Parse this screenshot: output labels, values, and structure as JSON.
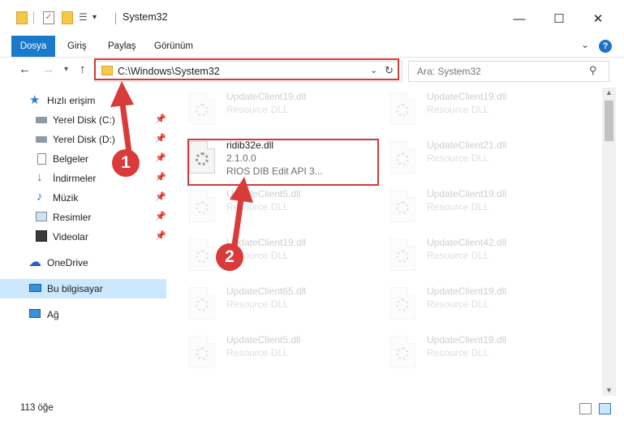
{
  "window": {
    "title": "System32"
  },
  "ribbon": {
    "tabs": [
      "Dosya",
      "Giriş",
      "Paylaş",
      "Görünüm"
    ]
  },
  "nav": {
    "address": "C:\\Windows\\System32",
    "search_placeholder": "Ara: System32"
  },
  "sidebar": {
    "items": [
      {
        "label": "Hızlı erişim",
        "icon": "star-icon"
      },
      {
        "label": "Yerel Disk (C:)",
        "icon": "drive-icon",
        "pinned": true
      },
      {
        "label": "Yerel Disk (D:)",
        "icon": "drive-icon",
        "pinned": true
      },
      {
        "label": "Belgeler",
        "icon": "documents-icon",
        "pinned": true
      },
      {
        "label": "İndirmeler",
        "icon": "download-icon",
        "pinned": true
      },
      {
        "label": "Müzik",
        "icon": "music-icon",
        "pinned": true
      },
      {
        "label": "Resimler",
        "icon": "pictures-icon",
        "pinned": true
      },
      {
        "label": "Videolar",
        "icon": "video-icon",
        "pinned": true
      },
      {
        "label": "OneDrive",
        "icon": "cloud-icon"
      },
      {
        "label": "Bu bilgisayar",
        "icon": "computer-icon",
        "selected": true
      },
      {
        "label": "Ağ",
        "icon": "network-icon"
      }
    ]
  },
  "files": {
    "highlighted": {
      "name": "ridib32e.dll",
      "version": "2.1.0.0",
      "description": "RIOS DIB Edit API 3..."
    },
    "faded": [
      {
        "name": "UpdateClient19.dll",
        "type": "Resource DLL"
      },
      {
        "name": "UpdateClient19.dll",
        "type": "Resource DLL"
      },
      {
        "name": "UpdateClient21.dll",
        "type": "Resource DLL"
      },
      {
        "name": "UpdateClient5.dll",
        "type": "Resource DLL"
      },
      {
        "name": "UpdateClient19.dll",
        "type": "Resource DLL"
      },
      {
        "name": "UpdateClient19.dll",
        "type": "Resource DLL"
      },
      {
        "name": "UpdateClient42.dll",
        "type": "Resource DLL"
      },
      {
        "name": "UpdateClient65.dll",
        "type": "Resource DLL"
      },
      {
        "name": "UpdateClient19.dll",
        "type": "Resource DLL"
      },
      {
        "name": "UpdateClient5.dll",
        "type": "Resource DLL"
      },
      {
        "name": "UpdateClient19.dll",
        "type": "Resource DLL"
      }
    ]
  },
  "status": {
    "count": "113 öğe"
  },
  "annotations": {
    "step1": "1",
    "step2": "2",
    "color": "#d93a3a"
  }
}
